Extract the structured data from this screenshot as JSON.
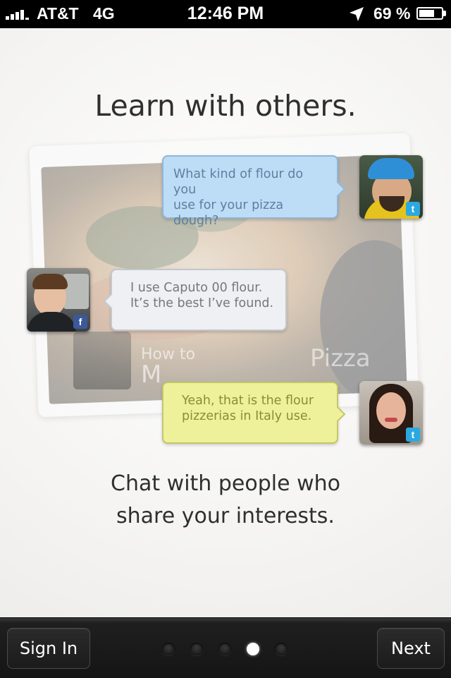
{
  "status_bar": {
    "carrier": "AT&T",
    "network": "4G",
    "time": "12:46 PM",
    "battery_percent": "69 %",
    "battery_level": 0.69,
    "icons": [
      "signal-bars-icon",
      "location-arrow-icon",
      "battery-icon"
    ]
  },
  "screen": {
    "title": "Learn with others.",
    "subtitle_line1": "Chat with people who",
    "subtitle_line2": "share your interests."
  },
  "background_card": {
    "caption_line1": "How to",
    "caption_line2": "M",
    "caption_right": "Pizza"
  },
  "messages": [
    {
      "line1": "What kind of flour do you",
      "line2": "use for your pizza dough?",
      "network": "twitter",
      "bubble_color": "#bddcf6"
    },
    {
      "line1": "I use Caputo 00 flour.",
      "line2": "It’s the best I’ve found.",
      "network": "facebook",
      "bubble_color": "#eef0f3"
    },
    {
      "line1": "Yeah, that is the flour",
      "line2": "pizzerias in Italy use.",
      "network": "twitter",
      "bubble_color": "#eef19a"
    }
  ],
  "badges": {
    "twitter": "t",
    "facebook": "f"
  },
  "bottom_bar": {
    "sign_in_label": "Sign In",
    "next_label": "Next",
    "page_count": 5,
    "current_page": 4
  }
}
